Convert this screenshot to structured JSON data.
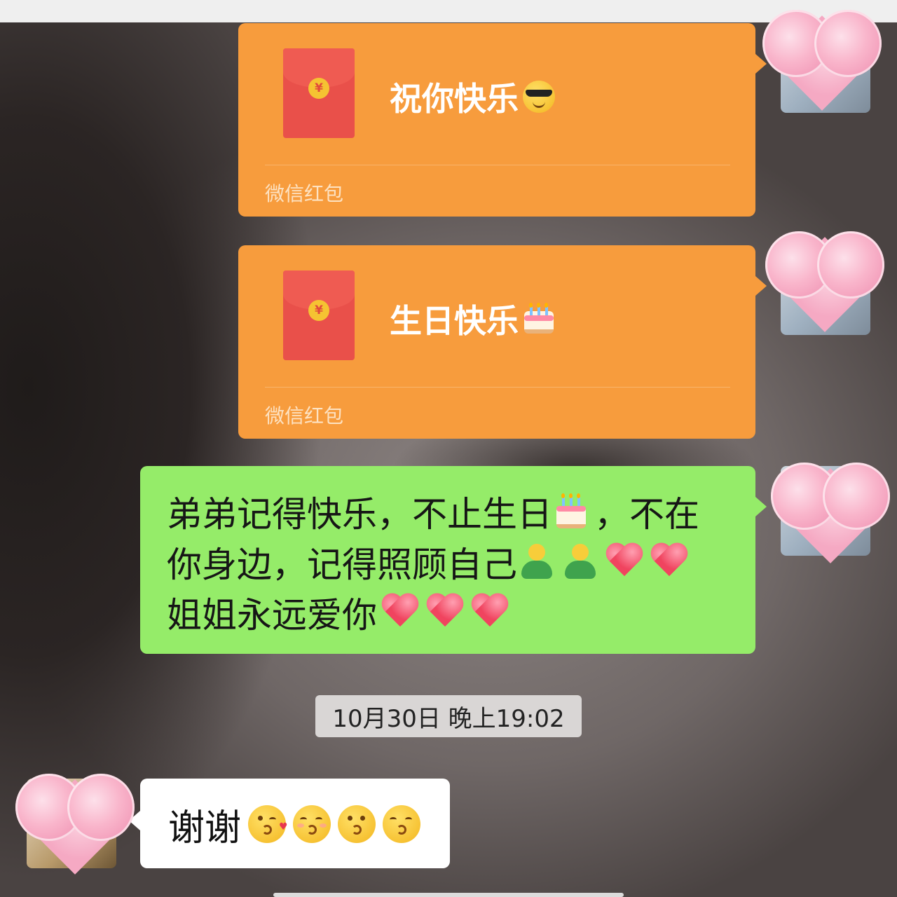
{
  "messages": {
    "packet1": {
      "title": "祝你快乐",
      "emoji": "smiling-face-with-sunglasses",
      "footer": "微信红包"
    },
    "packet2": {
      "title": "生日快乐",
      "emoji": "birthday-cake",
      "footer": "微信红包"
    },
    "text_msg": {
      "line1_a": "弟弟记得快乐，不止生日",
      "line1_b": "，不在",
      "line2": "你身边，记得照顾自己",
      "line3": "姐姐永远爱你"
    },
    "timestamp": "10月30日 晚上19:02",
    "reply": {
      "text": "谢谢"
    }
  },
  "envelope": {
    "coin_symbol": "¥"
  },
  "colors": {
    "red_packet": "#f79c3d",
    "sent_bubble": "#95ec69",
    "received_bubble": "#ffffff",
    "timestamp_bg": "#d9d6d5"
  }
}
